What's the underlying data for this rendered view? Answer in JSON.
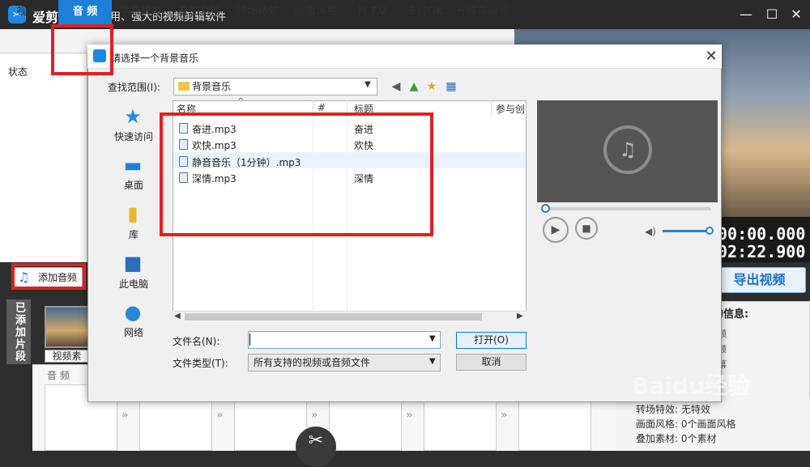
{
  "app": {
    "name": "爱剪辑",
    "slogan": "最易用、强大的视频剪辑软件",
    "logo_glyph": "✂"
  },
  "tabs": [
    "视  频",
    "音  频",
    "字幕特效",
    "叠加素材",
    "转场特效",
    "画面风格",
    "M.T.V",
    "卡拉OK",
    "升级与服务"
  ],
  "left_panel": {
    "status_col": "状态",
    "add_audio": "添加音频",
    "added_clips": "已添加片段",
    "clip_name": "视频素",
    "track_label": "音  频"
  },
  "timecode": {
    "current": "00:00.000",
    "total": "02:22.900"
  },
  "export_label": "导出视频",
  "info": {
    "title": "的信息:",
    "lines": [
      "频",
      "频",
      "幕"
    ]
  },
  "bottom_info": [
    {
      "label": "转场特效:",
      "value": "无特效"
    },
    {
      "label": "画面风格:",
      "value": "0个画面风格"
    },
    {
      "label": "叠加素材:",
      "value": "0个素材"
    }
  ],
  "dialog": {
    "title": "请选择一个背景音乐",
    "lookin_label": "查找范围(I):",
    "lookin_value": "背景音乐",
    "places": [
      "快速访问",
      "桌面",
      "库",
      "此电脑",
      "网络"
    ],
    "columns": [
      "名称",
      "#",
      "标题",
      "参与创"
    ],
    "files": [
      {
        "name": "奋进.mp3",
        "title": "奋进"
      },
      {
        "name": "欢快.mp3",
        "title": "欢快"
      },
      {
        "name": "静音音乐（1分钟）.mp3",
        "title": ""
      },
      {
        "name": "深情.mp3",
        "title": "深情"
      }
    ],
    "filename_label": "文件名(N):",
    "filename_value": "",
    "filetype_label": "文件类型(T):",
    "filetype_value": "所有支持的视频或音频文件",
    "open_label": "打开(O)",
    "cancel_label": "取消"
  },
  "watermark": "Baidu经验",
  "colors": {
    "accent": "#1e7fd8",
    "annotation": "#e02020"
  }
}
